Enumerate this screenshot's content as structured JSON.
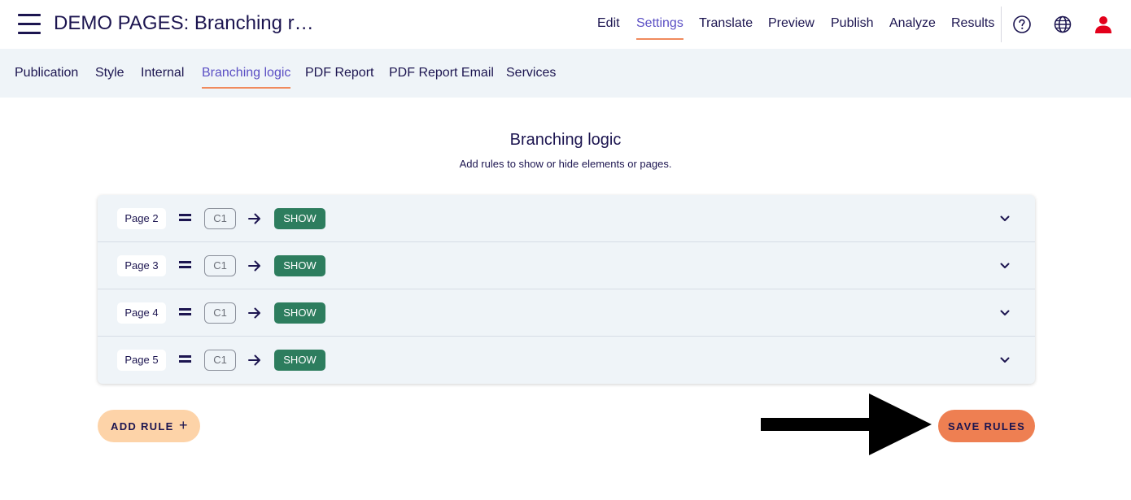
{
  "header": {
    "title": "DEMO PAGES: Branching r…",
    "nav": [
      {
        "label": "Edit"
      },
      {
        "label": "Settings",
        "active": true
      },
      {
        "label": "Translate"
      },
      {
        "label": "Preview"
      },
      {
        "label": "Publish"
      },
      {
        "label": "Analyze"
      },
      {
        "label": "Results"
      }
    ],
    "icons": [
      "help-icon",
      "globe-icon",
      "user-icon"
    ],
    "user_icon_color": "#e3001b"
  },
  "subnav": {
    "items": [
      {
        "label": "Publication"
      },
      {
        "label": "Style"
      },
      {
        "label": "Internal"
      },
      {
        "label": "Branching logic",
        "active": true
      },
      {
        "label": "PDF Report"
      },
      {
        "label": "PDF Report Email"
      },
      {
        "label": "Services"
      }
    ]
  },
  "section": {
    "title": "Branching logic",
    "subtitle": "Add rules to show or hide elements or pages."
  },
  "rules": [
    {
      "target": "Page 2",
      "condition": "C1",
      "action": "SHOW"
    },
    {
      "target": "Page 3",
      "condition": "C1",
      "action": "SHOW"
    },
    {
      "target": "Page 4",
      "condition": "C1",
      "action": "SHOW"
    },
    {
      "target": "Page 5",
      "condition": "C1",
      "action": "SHOW"
    }
  ],
  "buttons": {
    "add_rule": "ADD RULE",
    "add_rule_icon": "+",
    "save_rules": "SAVE RULES"
  },
  "colors": {
    "accent": "#5b4fc4",
    "underline": "#f08a5d",
    "show_chip": "#2d7d5e",
    "add_button": "#fdd3a8",
    "save_button": "#ee7f52"
  }
}
